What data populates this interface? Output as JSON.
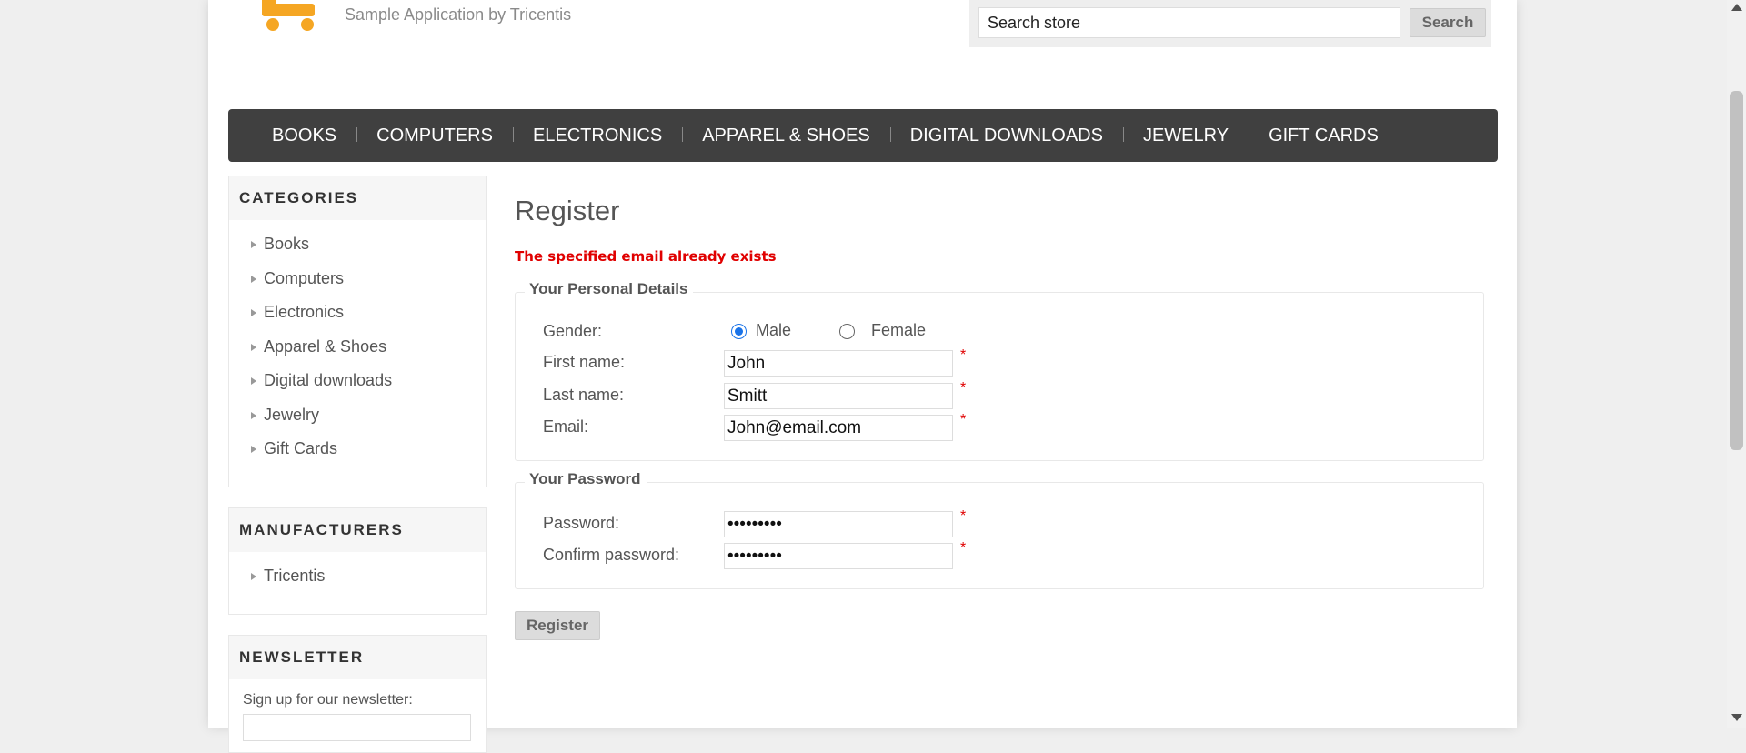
{
  "header": {
    "logo_subtitle": "Sample Application by Tricentis",
    "search": {
      "placeholder": "Search store",
      "button_label": "Search"
    }
  },
  "top_menu": [
    "BOOKS",
    "COMPUTERS",
    "ELECTRONICS",
    "APPAREL & SHOES",
    "DIGITAL DOWNLOADS",
    "JEWELRY",
    "GIFT CARDS"
  ],
  "sidebar": {
    "categories": {
      "title": "CATEGORIES",
      "items": [
        "Books",
        "Computers",
        "Electronics",
        "Apparel & Shoes",
        "Digital downloads",
        "Jewelry",
        "Gift Cards"
      ]
    },
    "manufacturers": {
      "title": "MANUFACTURERS",
      "items": [
        "Tricentis"
      ]
    },
    "newsletter": {
      "title": "NEWSLETTER",
      "text": "Sign up for our newsletter:"
    }
  },
  "main": {
    "title": "Register",
    "error": "The specified email already exists",
    "personal": {
      "legend": "Your Personal Details",
      "gender_label": "Gender:",
      "gender_options": [
        "Male",
        "Female"
      ],
      "gender_selected": "Male",
      "first_name_label": "First name:",
      "first_name_value": "John",
      "last_name_label": "Last name:",
      "last_name_value": "Smitt",
      "email_label": "Email:",
      "email_value": "John@email.com"
    },
    "password": {
      "legend": "Your Password",
      "password_label": "Password:",
      "password_value": "•••••••••",
      "confirm_label": "Confirm password:",
      "confirm_value": "•••••••••"
    },
    "required_marker": "*",
    "register_button": "Register"
  },
  "colors": {
    "accent": "#f5a623",
    "error": "#e00000",
    "menu_bg": "#404040",
    "radio_checked": "#1a73e8"
  },
  "icons": {
    "logo": "shopping-cart-icon",
    "list_bullet": "triangle-right-icon"
  }
}
